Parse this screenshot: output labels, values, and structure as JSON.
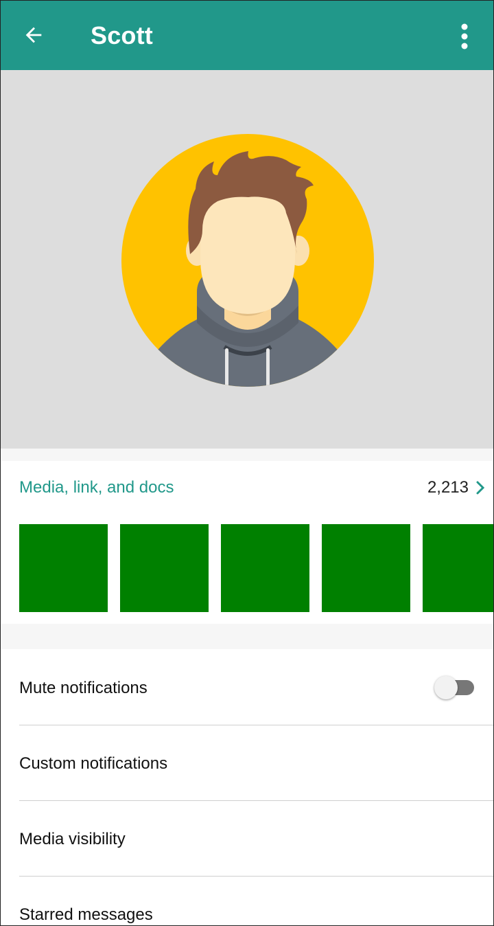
{
  "header": {
    "title": "Scott",
    "back_icon": "arrow-left-icon",
    "menu_icon": "more-vertical-icon",
    "background": "#21988a"
  },
  "profile_photo": {
    "icon": "avatar-illustration",
    "background": "#dddddd",
    "circle_color": "#ffc200"
  },
  "media": {
    "label": "Media, link, and docs",
    "count": "2,213",
    "chevron_icon": "chevron-right-icon",
    "thumbnail_color": "#008000",
    "thumbnail_count": 5
  },
  "settings": {
    "mute_notifications": {
      "label": "Mute notifications",
      "toggle_on": false
    },
    "custom_notifications": {
      "label": "Custom notifications"
    },
    "media_visibility": {
      "label": "Media visibility"
    },
    "starred_messages": {
      "label": "Starred messages"
    }
  }
}
